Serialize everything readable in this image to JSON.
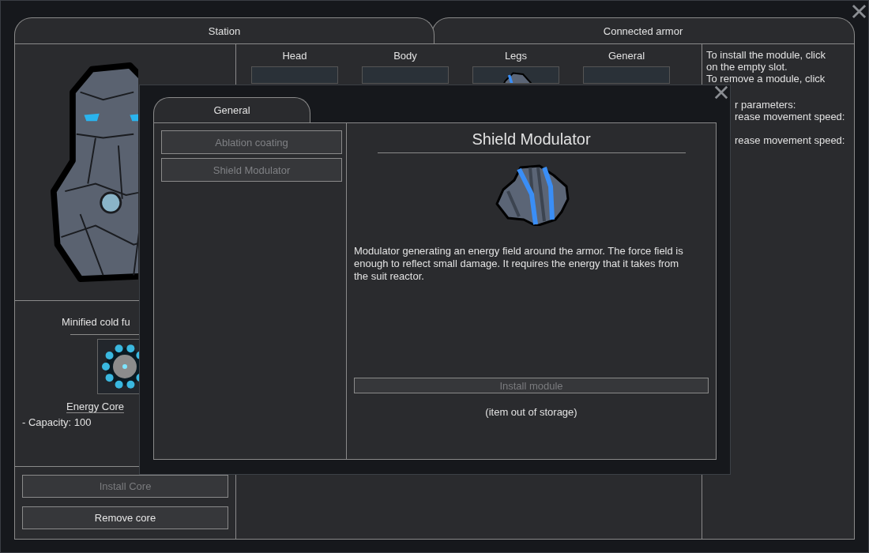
{
  "tabs": [
    {
      "label": "Station"
    },
    {
      "label": "Connected armor"
    }
  ],
  "core": {
    "title": "Minified cold fu",
    "name": "Energy Core",
    "stats": [
      "- Capacity: 100"
    ]
  },
  "core_buttons": [
    {
      "label": "Install Core",
      "disabled": true
    },
    {
      "label": "Remove core",
      "disabled": false
    }
  ],
  "slots": [
    {
      "label": "Head",
      "filled": false
    },
    {
      "label": "Body",
      "filled": false
    },
    {
      "label": "Legs",
      "filled": true
    },
    {
      "label": "General",
      "filled": false
    }
  ],
  "help_lines": [
    {
      "text": "To install the module, click",
      "covered": false
    },
    {
      "text": "on the empty slot.",
      "covered": false
    },
    {
      "text": "To remove a module, click",
      "covered": false
    },
    {
      "text": "r parameters:",
      "covered": true
    },
    {
      "text": "rease movement speed:",
      "covered": true
    },
    {
      "text": "rease movement speed:",
      "covered": true
    }
  ],
  "dialog": {
    "tabs": [
      {
        "label": "General"
      }
    ],
    "modules": [
      {
        "label": "Ablation coating"
      },
      {
        "label": "Shield Modulator"
      }
    ],
    "title": "Shield Modulator",
    "description": "Modulator generating an energy field around the armor. The force field is enough to reflect small damage. It requires the energy that it takes from the suit reactor.",
    "install_button": {
      "label": "Install module",
      "disabled": true
    },
    "note": "(item out of storage)"
  }
}
